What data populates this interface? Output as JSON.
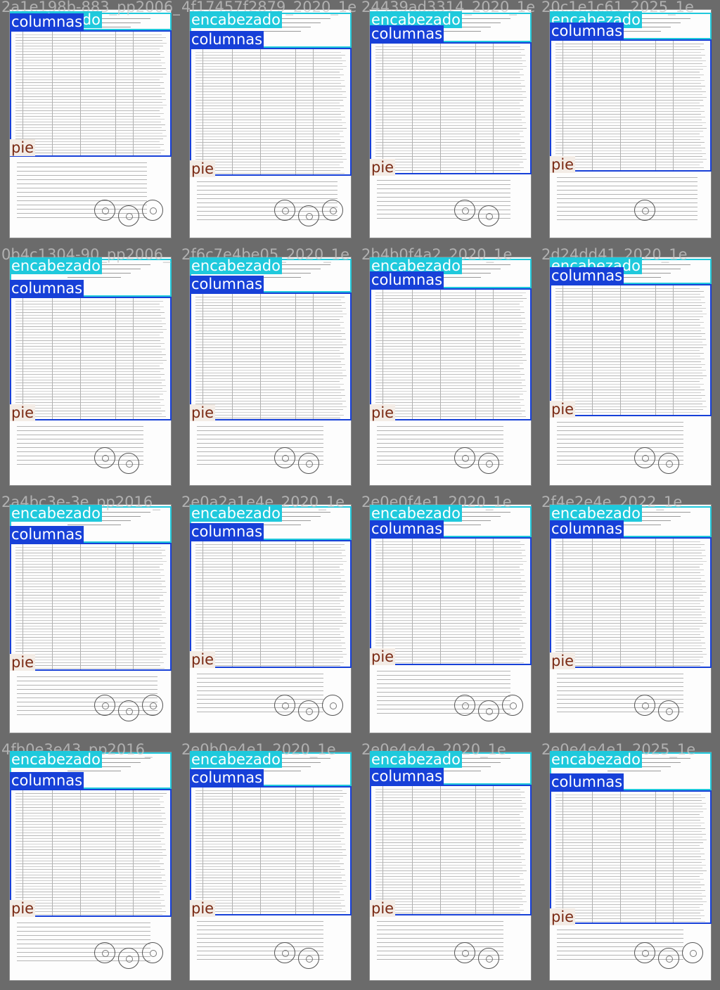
{
  "labels": {
    "header": "encabezado",
    "columns": "columnas",
    "footer": "pie"
  },
  "colors": {
    "header_box": "#1fc9dc",
    "columns_box": "#1740d8",
    "footer_label_text": "#7a2a14",
    "background": "#6b6b6b"
  },
  "tiles": [
    {
      "filename": "2a1e198b-883_pp2006_",
      "stamps": 3
    },
    {
      "filename": "4f17457f2879_2020_1e",
      "stamps": 3
    },
    {
      "filename": "24439ad3314_2020_1e",
      "stamps": 2
    },
    {
      "filename": "20c1e1c61_2025_1e",
      "stamps": 1
    },
    {
      "filename": "0b4c1304-90_pp2006_",
      "stamps": 2
    },
    {
      "filename": "2f6c7e4be05_2020_1e",
      "stamps": 2
    },
    {
      "filename": "2b4b0f4a2_2020_1e",
      "stamps": 2
    },
    {
      "filename": "2d24dd41_2020_1e",
      "stamps": 2
    },
    {
      "filename": "2a4bc3e-3e_pp2016_",
      "stamps": 3
    },
    {
      "filename": "2e0a2a1e4e_2020_1e",
      "stamps": 3
    },
    {
      "filename": "2e0e0f4e1_2020_1e",
      "stamps": 3
    },
    {
      "filename": "2f4e2e4e_2022_1e",
      "stamps": 2
    },
    {
      "filename": "4fb0e3e43_pp2016_",
      "stamps": 3
    },
    {
      "filename": "2e0b0e4e1_2020_1e",
      "stamps": 2
    },
    {
      "filename": "2e0e4e4e_2020_1e",
      "stamps": 2
    },
    {
      "filename": "2e0e4e4e1_2025_1e",
      "stamps": 3
    }
  ]
}
